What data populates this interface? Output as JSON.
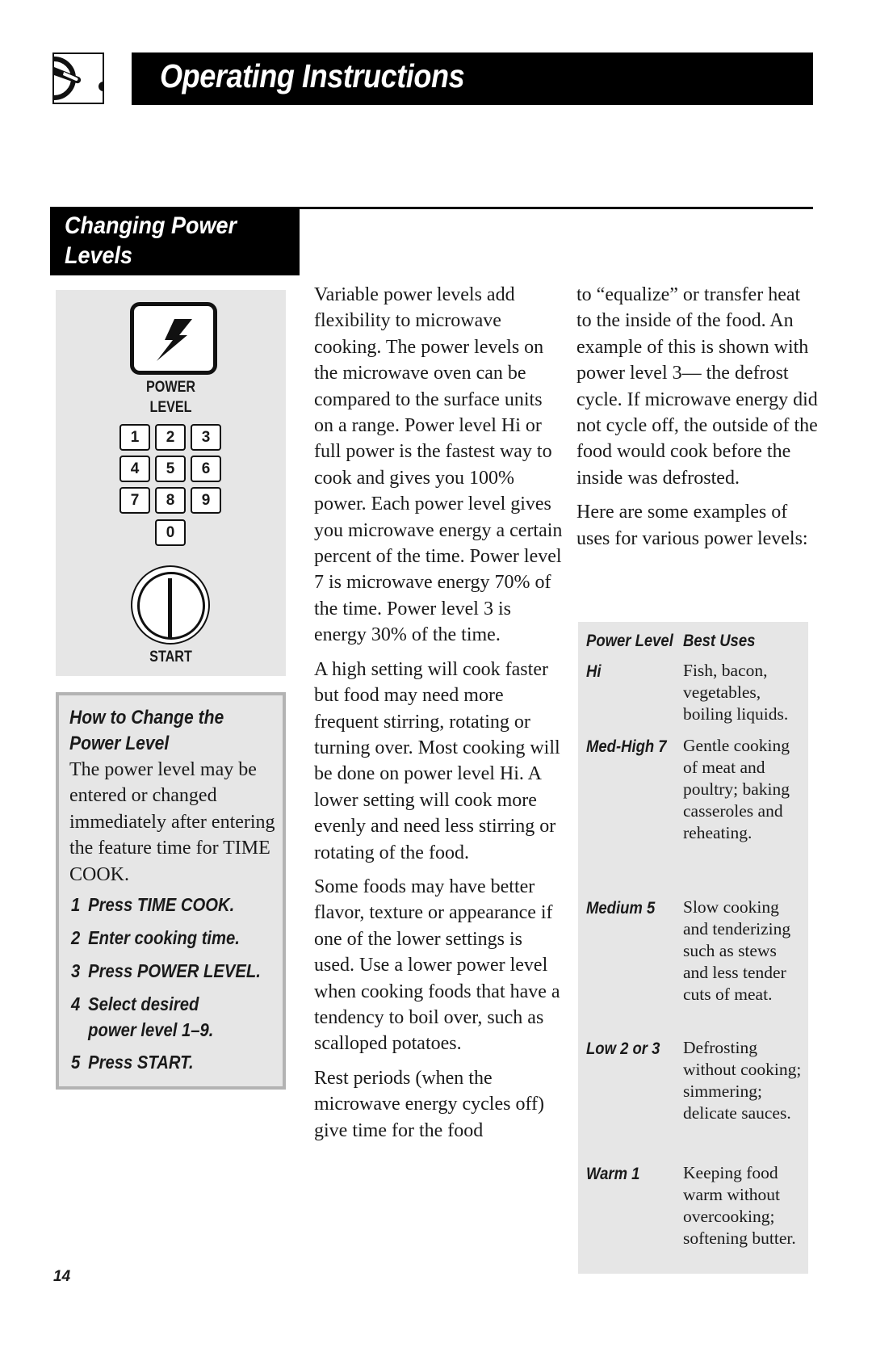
{
  "header": {
    "icon": "microwave-dial-icon",
    "title": "Operating Instructions"
  },
  "section": {
    "title_line1": "Changing Power",
    "title_line2": "Levels"
  },
  "panel": {
    "power_icon": "lightning-bolt-icon",
    "power_label_line1": "POWER",
    "power_label_line2": "LEVEL",
    "keys": [
      "1",
      "2",
      "3",
      "4",
      "5",
      "6",
      "7",
      "8",
      "9",
      "0"
    ],
    "start_icon": "start-power-icon",
    "start_label": "START"
  },
  "howto": {
    "title_line1": "How to Change the",
    "title_line2": "Power Level",
    "body": "The power level may be entered or changed immediately after entering the feature time for TIME COOK.",
    "steps": [
      {
        "num": "1",
        "text": "Press TIME COOK."
      },
      {
        "num": "2",
        "text": "Enter cooking time."
      },
      {
        "num": "3",
        "text": "Press POWER LEVEL."
      },
      {
        "num": "4",
        "text": "Select desired power level 1–9."
      },
      {
        "num": "5",
        "text": "Press START."
      }
    ]
  },
  "body": {
    "middle_paragraphs": [
      "Variable power levels add flexibility to microwave cooking. The power levels on the microwave oven can be compared to the surface units on a range. Power level Hi or full power is the fastest way to cook and gives you 100% power. Each power level gives you microwave energy a certain percent of the time. Power level 7 is microwave energy 70% of the time. Power level 3 is energy 30% of the time.",
      "A high setting will cook faster but food may need more frequent stirring, rotating or turning over. Most cooking will be done on power level Hi. A lower setting will cook more evenly and need less stirring or rotating of the food.",
      "Some foods may have better flavor, texture or appearance if one of the lower settings is used. Use a lower power level when cooking foods that have a tendency to boil over, such as scalloped potatoes.",
      "Rest periods (when the microwave energy cycles off) give time for the food"
    ],
    "right_paragraphs": [
      "to “equalize” or transfer heat to the inside of the food. An example of this is shown with power level 3— the defrost cycle. If microwave energy did not cycle off, the outside of the food would cook before the inside was defrosted.",
      "Here are some examples of uses for various power levels:"
    ]
  },
  "table": {
    "headers": [
      "Power Level",
      "Best Uses"
    ],
    "rows": [
      {
        "level": "Hi",
        "uses": "Fish, bacon, vegetables, boiling liquids."
      },
      {
        "level": "Med-High 7",
        "uses": "Gentle cooking of meat and poultry; baking casseroles and reheating."
      },
      {
        "level": "Medium 5",
        "uses": "Slow cooking and tenderizing such as stews and less tender cuts of meat."
      },
      {
        "level": "Low 2 or 3",
        "uses": "Defrosting without cooking; simmering; delicate sauces."
      },
      {
        "level": "Warm 1",
        "uses": "Keeping food warm without overcooking; softening butter."
      }
    ]
  },
  "footer": {
    "page_number": "14"
  }
}
